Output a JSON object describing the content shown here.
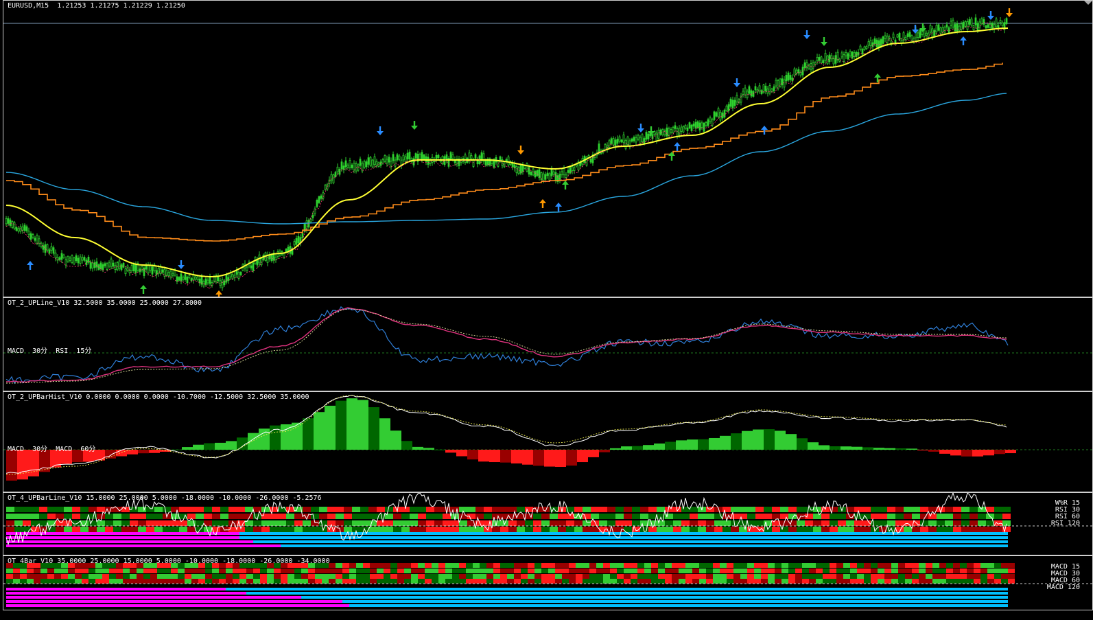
{
  "header": {
    "symbol": "EURUSD,M15",
    "ohlc": "1.21253 1.21275 1.21229 1.21250"
  },
  "panes": {
    "p1": {
      "title": "OT_2_UPLine_V10 32.5000 35.0000 25.0000 27.8000",
      "legend": "MACD  30分  RSI  15分"
    },
    "p2": {
      "title": "OT_2_UPBarHist_V10 0.0000 0.0000 0.0000 -10.7000 -12.5000 32.5000 35.0000",
      "legend": "MACD  30分  MACD  60分"
    },
    "p3": {
      "title": "OT_4_UPBarLine_V10 15.0000 25.0000 5.0000 -18.0000 -10.0000 -26.0000 -5.2576",
      "rows": [
        "W%R  15",
        "RSI  30",
        "RSI  60",
        "RSI  120"
      ]
    },
    "p4": {
      "title": "OT_4Bar_V10 35.0000 25.0000 15.0000 5.0000 -10.0000 -18.0000 -26.0000 -34.0000",
      "rows": [
        "MACD  15",
        "MACD  30",
        "MACD  60",
        "MACD  120"
      ]
    }
  },
  "colors": {
    "candle": "#2fd12f",
    "ma_fast": "#ffff33",
    "ma_mid": "#ff8c1a",
    "ma_slow": "#2aa7e0",
    "signal": "#ff3377",
    "hist_up": "#33cc33",
    "hist_up_dark": "#006600",
    "hist_down": "#ff1a1a",
    "hist_down_dark": "#990000",
    "magenta": "#ff00ff",
    "cyan": "#00bfff",
    "arrow_blue": "#2a8cff",
    "arrow_green": "#33cc33",
    "arrow_orange": "#ff9900"
  },
  "chart_data": [
    {
      "type": "line",
      "series_role": "main price chart (candles + moving averages)",
      "x": [
        0,
        100,
        200,
        300,
        400,
        500,
        600,
        700,
        800,
        900,
        1000,
        1100,
        1200,
        1300,
        1400,
        1460
      ],
      "series": [
        {
          "values": [
            325,
            380,
            392,
            410,
            370,
            240,
            230,
            232,
            255,
            205,
            185,
            130,
            85,
            55,
            35,
            33
          ]
        },
        {
          "values": [
            298,
            345,
            385,
            402,
            368,
            290,
            232,
            232,
            245,
            212,
            196,
            150,
            97,
            62,
            45,
            40
          ]
        },
        {
          "values": [
            262,
            305,
            345,
            350,
            340,
            315,
            290,
            275,
            262,
            240,
            215,
            190,
            140,
            110,
            100,
            90
          ]
        },
        {
          "values": [
            250,
            275,
            300,
            320,
            325,
            322,
            320,
            318,
            308,
            285,
            255,
            220,
            190,
            165,
            145,
            135
          ]
        }
      ]
    },
    {
      "type": "line",
      "series_role": "OT_2_UPLine oscillator pane",
      "x": [
        0,
        100,
        200,
        300,
        400,
        500,
        600,
        700,
        800,
        900,
        1000,
        1100,
        1200,
        1300,
        1400,
        1460
      ],
      "series": [
        {
          "values": [
            110,
            105,
            75,
            95,
            35,
            5,
            80,
            75,
            85,
            55,
            55,
            25,
            45,
            45,
            30,
            55
          ]
        },
        {
          "values": [
            112,
            110,
            90,
            90,
            60,
            5,
            30,
            50,
            75,
            55,
            50,
            30,
            40,
            45,
            45,
            50
          ]
        },
        {
          "values": [
            114,
            111,
            94,
            93,
            66,
            6,
            28,
            46,
            72,
            54,
            49,
            28,
            38,
            43,
            43,
            48
          ]
        }
      ]
    },
    {
      "type": "bar",
      "series_role": "OT_2_UPBarHist histogram pane",
      "x": [
        0,
        100,
        200,
        300,
        400,
        500,
        600,
        700,
        800,
        900,
        1000,
        1100,
        1200,
        1300,
        1400,
        1460
      ],
      "series": [
        {
          "values": [
            -45,
            -18,
            -5,
            10,
            37,
            75,
            3,
            -18,
            -25,
            5,
            15,
            30,
            5,
            2,
            -10,
            -5
          ]
        },
        {
          "values": [
            118,
            105,
            80,
            95,
            55,
            5,
            30,
            50,
            78,
            55,
            45,
            28,
            38,
            42,
            40,
            50
          ]
        },
        {
          "values": [
            120,
            108,
            82,
            95,
            58,
            5,
            28,
            48,
            74,
            54,
            44,
            26,
            36,
            40,
            40,
            48
          ]
        }
      ]
    },
    {
      "type": "line",
      "series_role": "OT_4_UPBarLine oscillator line",
      "x": [
        0,
        100,
        200,
        300,
        400,
        500,
        600,
        700,
        800,
        900,
        1000,
        1100,
        1200,
        1300,
        1400,
        1460
      ],
      "series": [
        {
          "values": [
            65,
            40,
            15,
            55,
            20,
            60,
            10,
            45,
            20,
            60,
            15,
            50,
            20,
            55,
            5,
            50
          ]
        }
      ]
    }
  ]
}
